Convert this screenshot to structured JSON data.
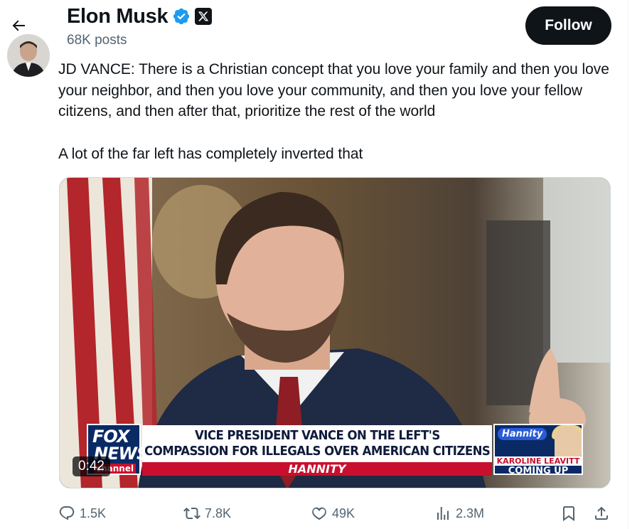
{
  "header": {
    "back_icon": "arrow-left-icon",
    "name": "Elon Musk",
    "verified_icon": "verified-badge-icon",
    "affiliate_icon": "x-logo-icon",
    "posts": "68K posts",
    "follow_label": "Follow"
  },
  "tweet": {
    "paragraphs": [
      "JD VANCE: There is a Christian concept that you love your family and then you love your neighbor, and then you love your community, and then you love your fellow citizens, and then after that, prioritize the rest of the world",
      "A lot of the far left has completely inverted that"
    ]
  },
  "media": {
    "type": "video",
    "timestamp": "0:42",
    "chyron": {
      "network_logo": "fox-news-logo",
      "headline_line1": "VICE PRESIDENT VANCE ON THE LEFT'S",
      "headline_line2": "COMPASSION FOR ILLEGALS OVER AMERICAN CITIZENS",
      "show_bar": "HANNITY",
      "promo_show": "Hannity",
      "promo_name": "KAROLINE LEAVITT",
      "promo_status": "COMING UP"
    }
  },
  "actions": {
    "reply": {
      "icon": "reply-icon",
      "count": "1.5K"
    },
    "repost": {
      "icon": "repost-icon",
      "count": "7.8K"
    },
    "like": {
      "icon": "heart-icon",
      "count": "49K"
    },
    "views": {
      "icon": "views-icon",
      "count": "2.3M"
    },
    "bookmark": {
      "icon": "bookmark-icon"
    },
    "share": {
      "icon": "share-icon"
    }
  },
  "colors": {
    "text_primary": "#0f1419",
    "text_secondary": "#536471",
    "verified_blue": "#1d9bf0",
    "follow_bg": "#0f1419"
  }
}
